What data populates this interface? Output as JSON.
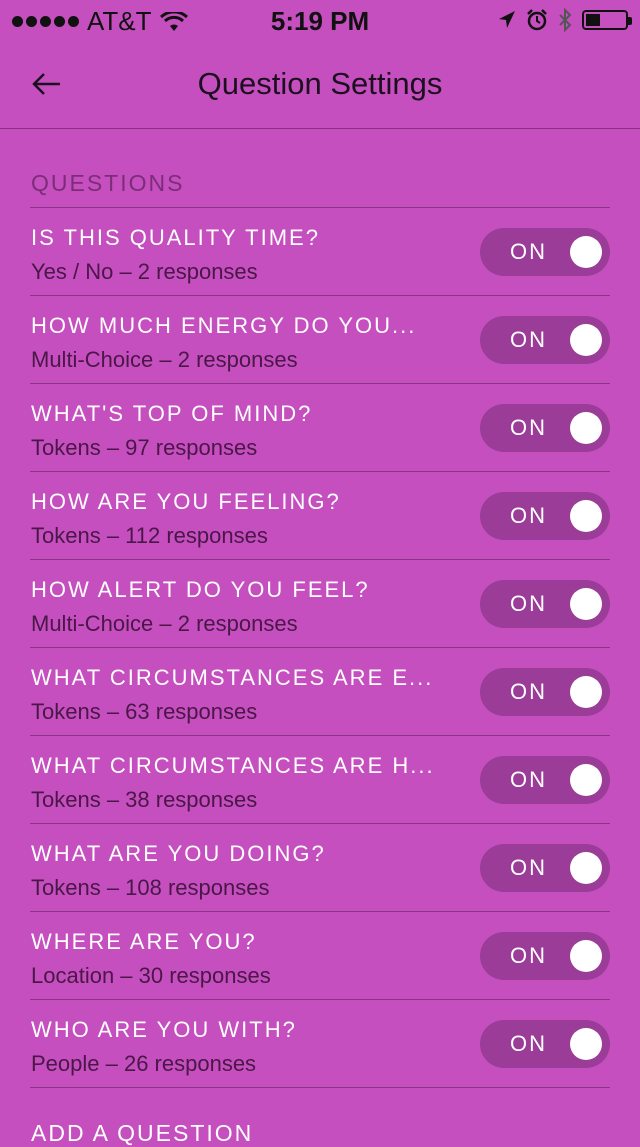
{
  "status_bar": {
    "carrier": "AT&T",
    "time": "5:19 PM"
  },
  "nav": {
    "title": "Question Settings"
  },
  "questions": {
    "header": "QUESTIONS",
    "items": [
      {
        "title": "IS THIS QUALITY TIME?",
        "subtitle": "Yes / No – 2 responses",
        "toggle": "ON"
      },
      {
        "title": "HOW MUCH ENERGY DO YOU...",
        "subtitle": "Multi-Choice – 2 responses",
        "toggle": "ON"
      },
      {
        "title": "WHAT'S TOP OF MIND?",
        "subtitle": "Tokens – 97 responses",
        "toggle": "ON"
      },
      {
        "title": "HOW ARE YOU FEELING?",
        "subtitle": "Tokens – 112 responses",
        "toggle": "ON"
      },
      {
        "title": "HOW ALERT DO YOU FEEL?",
        "subtitle": "Multi-Choice – 2 responses",
        "toggle": "ON"
      },
      {
        "title": "WHAT CIRCUMSTANCES ARE E...",
        "subtitle": "Tokens – 63 responses",
        "toggle": "ON"
      },
      {
        "title": "WHAT CIRCUMSTANCES ARE H...",
        "subtitle": "Tokens – 38 responses",
        "toggle": "ON"
      },
      {
        "title": "WHAT ARE YOU DOING?",
        "subtitle": "Tokens – 108 responses",
        "toggle": "ON"
      },
      {
        "title": "WHERE ARE YOU?",
        "subtitle": "Location – 30 responses",
        "toggle": "ON"
      },
      {
        "title": "WHO ARE YOU WITH?",
        "subtitle": "People – 26 responses",
        "toggle": "ON"
      }
    ]
  },
  "add_question_label": "ADD A QUESTION",
  "colors": {
    "background": "#c54fbf",
    "toggle_track": "#9b3c98",
    "subtitle": "#4a1747"
  },
  "icons": [
    "signal-dots-icon",
    "wifi-icon",
    "location-arrow-icon",
    "alarm-icon",
    "bluetooth-icon",
    "battery-icon",
    "back-arrow-icon"
  ]
}
